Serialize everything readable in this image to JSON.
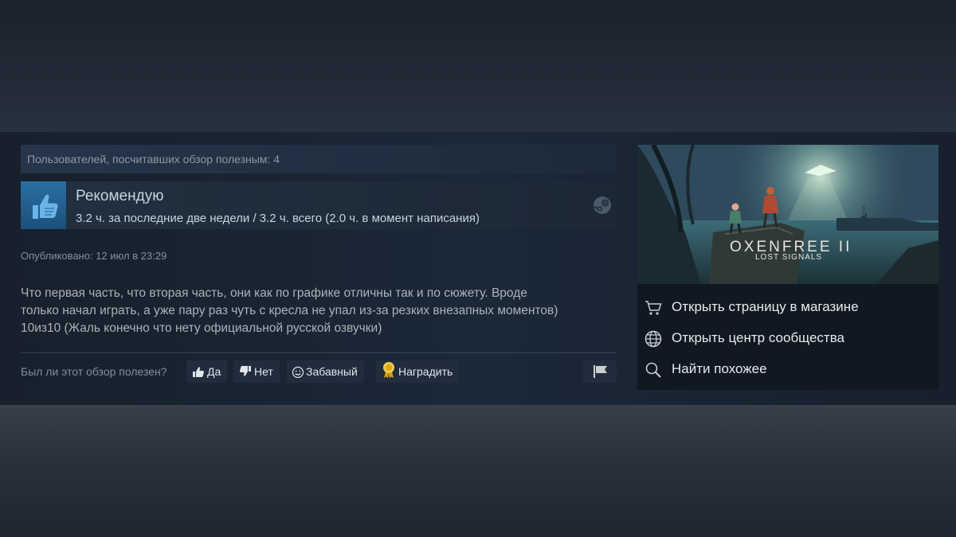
{
  "review": {
    "helpful_count_text": "Пользователей, посчитавших обзор полезным: 4",
    "verdict": "Рекомендую",
    "hours": "3.2 ч. за последние две недели / 3.2 ч. всего (2.0 ч. в момент написания)",
    "posted": "Опубликовано: 12 июл в 23:29",
    "text_lines": [
      "Что первая часть, что вторая часть, они как по графике отличны так и по сюжету. Вроде",
      "только начал играть, а уже пару раз чуть с кресла не упал из-за резких внезапных моментов)",
      "10из10 (Жаль конечно что нету официальной русской озвучки)"
    ],
    "helpful_question": "Был ли этот обзор полезен?",
    "buttons": {
      "yes": "Да",
      "no": "Нет",
      "funny": "Забавный",
      "award": "Наградить"
    }
  },
  "sidebar": {
    "logo_title": "OXENFREE II",
    "logo_subtitle": "LOST SIGNALS",
    "links": [
      {
        "label": "Открыть страницу в магазине",
        "icon": "cart-icon"
      },
      {
        "label": "Открыть центр сообщества",
        "icon": "globe-icon"
      },
      {
        "label": "Найти похожее",
        "icon": "magnifier-icon"
      }
    ]
  },
  "colors": {
    "accent_blue": "#2a6fa3",
    "panel_bg": "#1b2838",
    "award_gold": "#f2c94c"
  }
}
